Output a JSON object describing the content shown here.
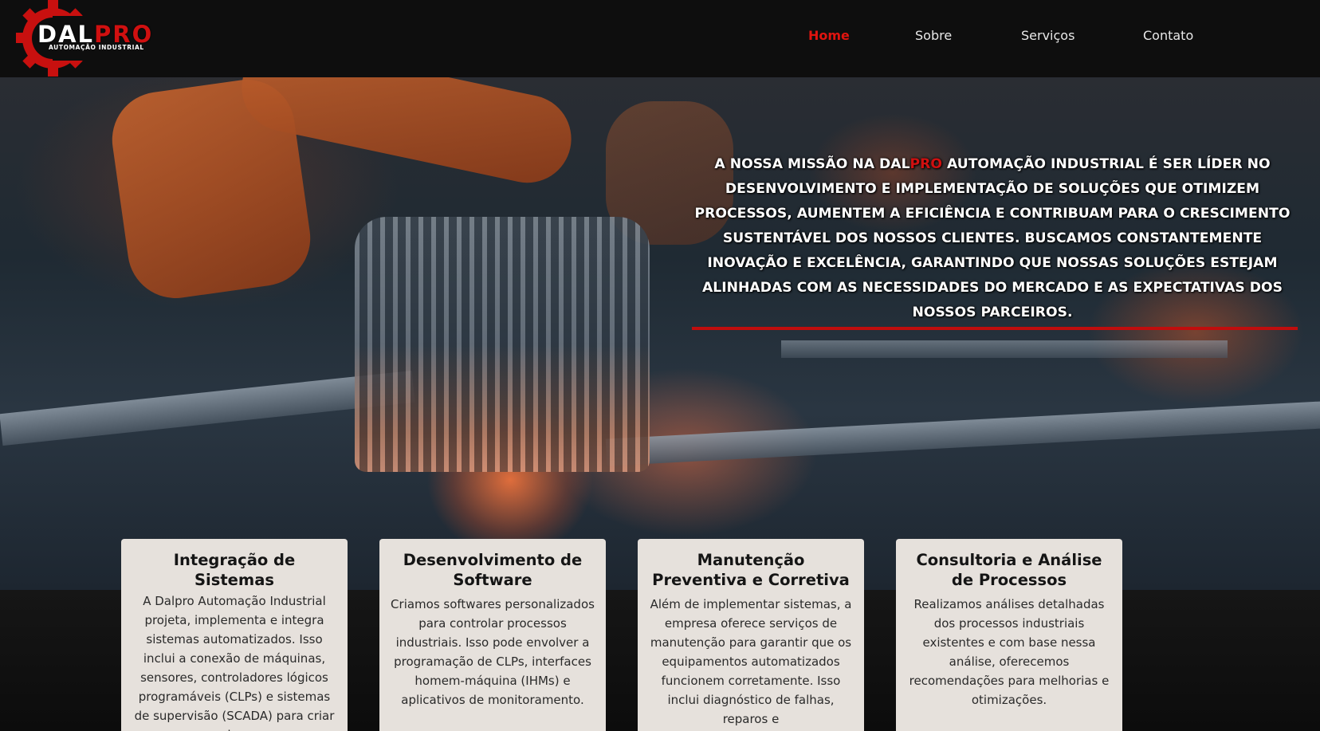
{
  "brand": {
    "name_main": "DAL",
    "name_accent": "PRO",
    "tagline": "AUTOMAÇÃO INDUSTRIAL",
    "accent_color": "#d01010"
  },
  "nav": {
    "items": [
      {
        "label": "Home",
        "active": true
      },
      {
        "label": "Sobre",
        "active": false
      },
      {
        "label": "Serviços",
        "active": false
      },
      {
        "label": "Contato",
        "active": false
      }
    ]
  },
  "hero": {
    "mission_before": "A NOSSA MISSÃO NA DAL",
    "mission_accent": "PRO",
    "mission_after": " AUTOMAÇÃO INDUSTRIAL É SER LÍDER NO DESENVOLVIMENTO E IMPLEMENTAÇÃO DE SOLUÇÕES QUE OTIMIZEM PROCESSOS, AUMENTEM A EFICIÊNCIA E CONTRIBUAM PARA O CRESCIMENTO SUSTENTÁVEL DOS NOSSOS CLIENTES. BUSCAMOS CONSTANTEMENTE INOVAÇÃO E EXCELÊNCIA, GARANTINDO QUE NOSSAS SOLUÇÕES ESTEJAM ALINHADAS COM AS NECESSIDADES DO MERCADO E AS EXPECTATIVAS DOS NOSSOS PARCEIROS."
  },
  "services": [
    {
      "title": "Integração de Sistemas",
      "text": "A Dalpro Automação Industrial projeta, implementa e integra sistemas automatizados. Isso inclui a conexão de máquinas, sensores, controladores lógicos programáveis (CLPs) e sistemas de supervisão (SCADA) para criar uma rede coesa e"
    },
    {
      "title": "Desenvolvimento de Software",
      "text": "Criamos softwares personalizados para controlar processos industriais. Isso pode envolver a programação de CLPs, interfaces homem-máquina (IHMs) e aplicativos de monitoramento."
    },
    {
      "title": "Manutenção Preventiva e Corretiva",
      "text": "Além de implementar sistemas, a empresa oferece serviços de manutenção para garantir que os equipamentos automatizados funcionem corretamente. Isso inclui diagnóstico de falhas, reparos e"
    },
    {
      "title": "Consultoria e Análise de Processos",
      "text": "Realizamos análises detalhadas dos processos industriais existentes e com base nessa análise, oferecemos recomendações para melhorias e otimizações."
    }
  ]
}
